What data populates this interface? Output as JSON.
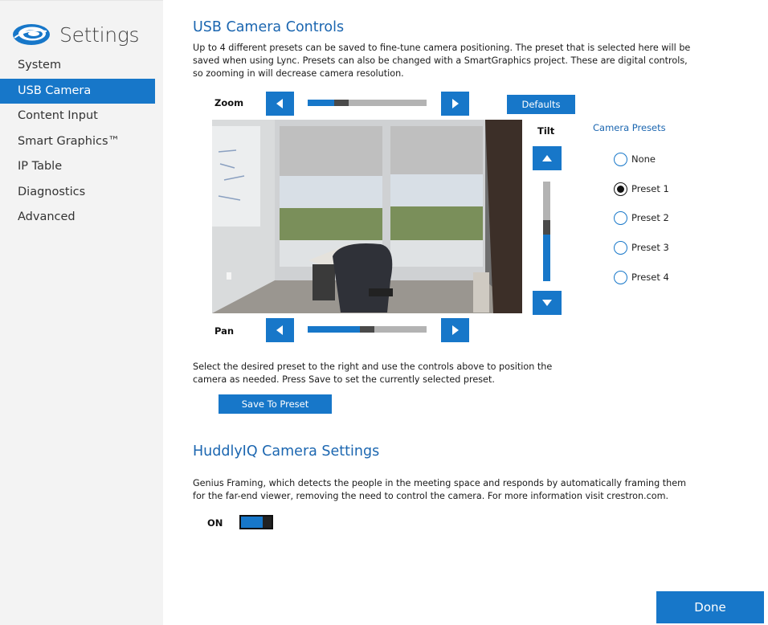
{
  "app": {
    "title": "Settings",
    "logo_icon": "swirl-logo-icon",
    "accent_color": "#1777c9"
  },
  "sidebar": {
    "items": [
      {
        "label": "System",
        "active": false
      },
      {
        "label": "USB Camera",
        "active": true
      },
      {
        "label": "Content Input",
        "active": false
      },
      {
        "label": "Smart Graphics™",
        "active": false
      },
      {
        "label": "IP Table",
        "active": false
      },
      {
        "label": "Diagnostics",
        "active": false
      },
      {
        "label": "Advanced",
        "active": false
      }
    ]
  },
  "usb_camera": {
    "title": "USB Camera Controls",
    "description": "Up to 4 different presets can be saved to fine-tune camera positioning.  The preset that is selected here will be saved when using Lync.  Presets can also be changed with a SmartGraphics project.  These are digital controls, so zooming in will decrease camera resolution.",
    "zoom": {
      "label": "Zoom",
      "level": 0.25
    },
    "defaults_label": "Defaults",
    "tilt": {
      "label": "Tilt",
      "level": 0.55
    },
    "pan": {
      "label": "Pan",
      "level": 0.5
    },
    "presets": {
      "title": "Camera Presets",
      "options": [
        "None",
        "Preset 1",
        "Preset 2",
        "Preset 3",
        "Preset 4"
      ],
      "selected": "Preset 1"
    },
    "instructions": "Select the desired preset to the right and use the controls above to position the camera as needed.  Press Save to set the currently selected preset.",
    "save_label": "Save To Preset"
  },
  "huddly": {
    "title": "HuddlyIQ Camera Settings",
    "description": "Genius Framing, which detects the people in the meeting space and responds by automatically framing them for the far-end viewer, removing the need to control the camera.  For more information visit crestron.com.",
    "toggle_label": "ON",
    "toggle_on": true
  },
  "footer": {
    "done_label": "Done"
  }
}
